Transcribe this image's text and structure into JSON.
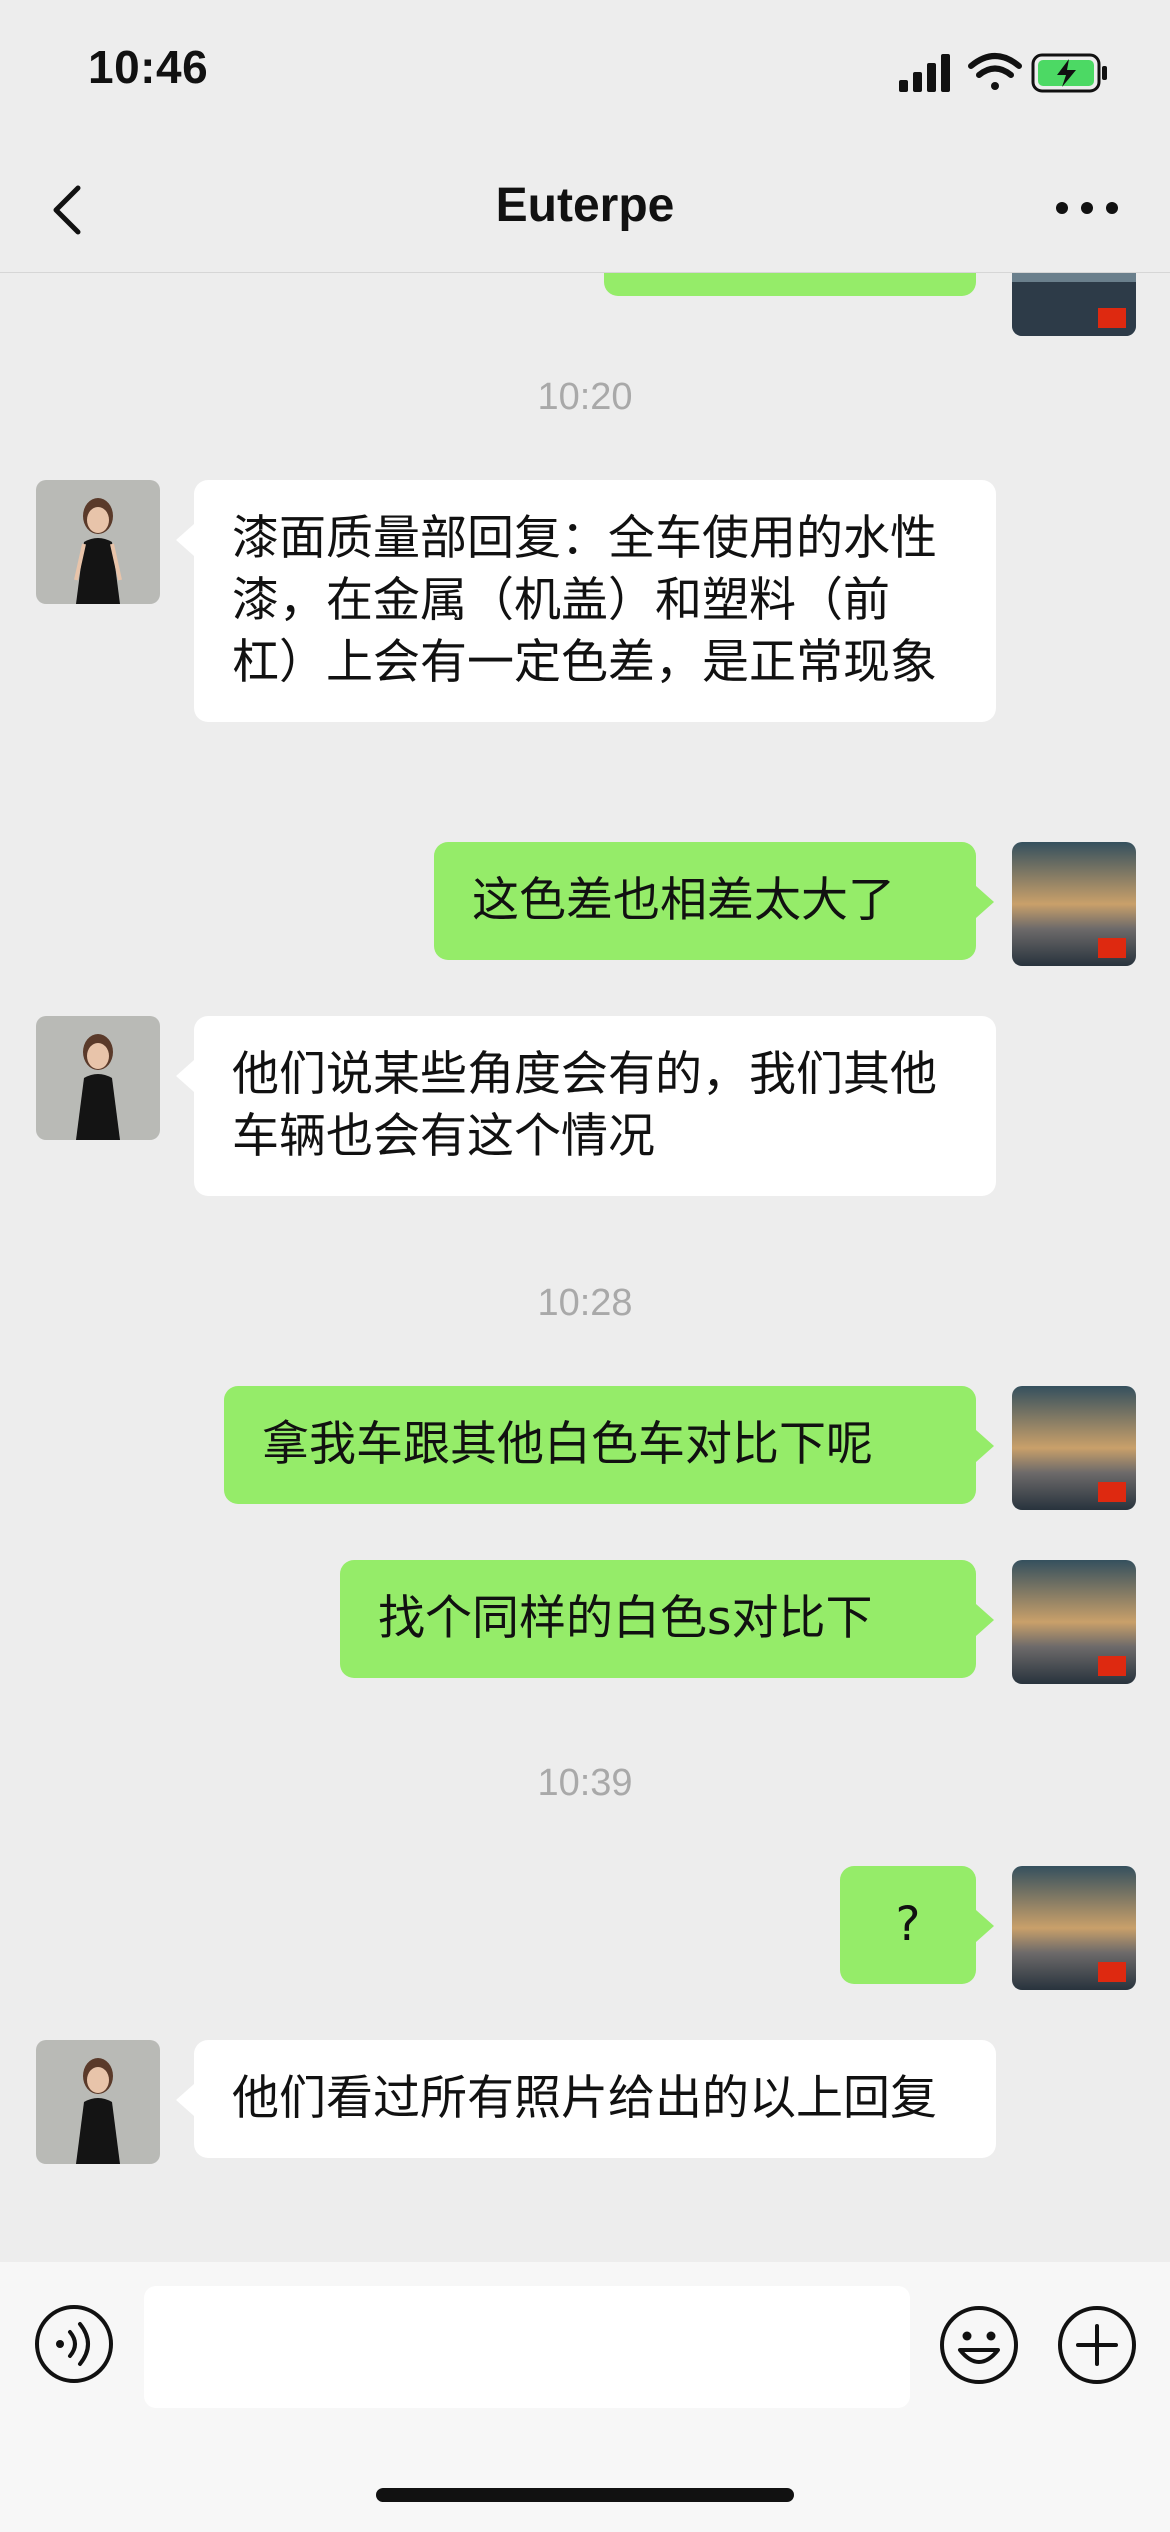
{
  "status": {
    "time": "10:46"
  },
  "nav": {
    "title": "Euterpe"
  },
  "messages": [
    {
      "type": "timestamp",
      "text": "10:20"
    },
    {
      "type": "in",
      "text": "漆面质量部回复：全车使用的水性漆，在金属（机盖）和塑料（前杠）上会有一定色差，是正常现象"
    },
    {
      "type": "out",
      "text": "这色差也相差太大了"
    },
    {
      "type": "in",
      "text": "他们说某些角度会有的，我们其他车辆也会有这个情况"
    },
    {
      "type": "timestamp",
      "text": "10:28"
    },
    {
      "type": "out",
      "text": "拿我车跟其他白色车对比下呢"
    },
    {
      "type": "out",
      "text": "找个同样的白色s对比下"
    },
    {
      "type": "timestamp",
      "text": "10:39"
    },
    {
      "type": "out",
      "text": "?"
    },
    {
      "type": "in",
      "text": "他们看过所有照片给出的以上回复"
    }
  ],
  "input": {
    "value": ""
  },
  "icons": {
    "back": "chevron-left-icon",
    "more": "more-dots-icon",
    "voice": "voice-icon",
    "emoji": "emoji-icon",
    "plus": "plus-icon"
  },
  "colors": {
    "outgoing_bubble": "#95ec69",
    "incoming_bubble": "#ffffff",
    "background": "#ededed"
  }
}
